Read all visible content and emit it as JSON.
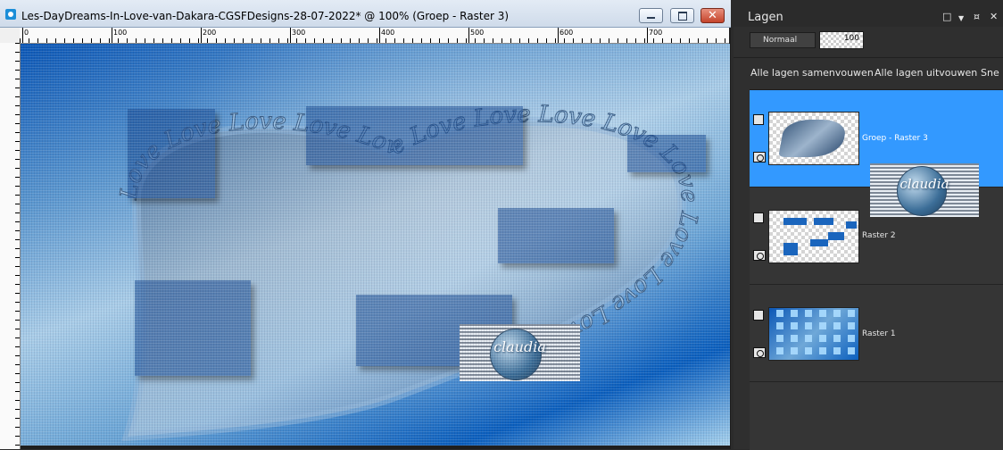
{
  "document": {
    "title": "Les-DayDreams-In-Love-van-Dakara-CGSFDesigns-28-07-2022* @ 100% (Groep - Raster 3)",
    "buttons": {
      "minimize": "minimize-icon",
      "maximize": "maximize-icon",
      "close": "close-icon",
      "close_glyph": "✕"
    },
    "ruler_labels": [
      "0",
      "100",
      "200",
      "300",
      "400",
      "500",
      "600",
      "700"
    ]
  },
  "canvas": {
    "heart_text": "Love Love Love Love Love Love Love Love Love Love Love Love Love Love",
    "watermark": "claudia"
  },
  "panel": {
    "title": "Lagen",
    "blend_mode": "Normaal",
    "opacity": "100",
    "actions": [
      "Alle lagen samenvouwen",
      "Alle lagen uitvouwen",
      "Sne"
    ],
    "header_icons": [
      "float-icon",
      "menu-chevron-icon",
      "pin-icon",
      "close-icon"
    ],
    "layers": [
      {
        "name": "Groep - Raster 3",
        "selected": true,
        "visible": true
      },
      {
        "name": "Raster 2",
        "selected": false,
        "visible": true
      },
      {
        "name": "Raster 1",
        "selected": false,
        "visible": true
      }
    ]
  },
  "colors": {
    "accent": "#3399ff",
    "panel_bg": "#2f2f2f",
    "canvas_blue": "#0b57b6"
  }
}
